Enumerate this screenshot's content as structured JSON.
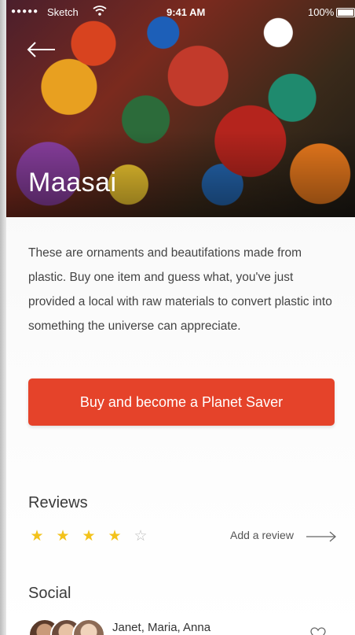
{
  "status_bar": {
    "signal_dots": "●●●●●",
    "carrier": "Sketch",
    "time": "9:41 AM",
    "battery": "100%"
  },
  "hero": {
    "title": "Maasai"
  },
  "description": "These are ornaments and beautifations made from plastic. Buy one item and guess what, you've just provided a local with raw materials to convert plastic into  something the universe can appreciate.",
  "cta": {
    "label": "Buy and become a Planet Saver"
  },
  "reviews": {
    "heading": "Reviews",
    "rating": 4,
    "max_rating": 5,
    "stars": [
      {
        "glyph": "★"
      },
      {
        "glyph": "★"
      },
      {
        "glyph": "★"
      },
      {
        "glyph": "★"
      },
      {
        "glyph": "☆"
      }
    ],
    "add_review_label": "Add a review"
  },
  "social": {
    "heading": "Social",
    "names": "Janet, Maria, Anna"
  },
  "colors": {
    "accent": "#e5432a",
    "star": "#f3c21b"
  }
}
